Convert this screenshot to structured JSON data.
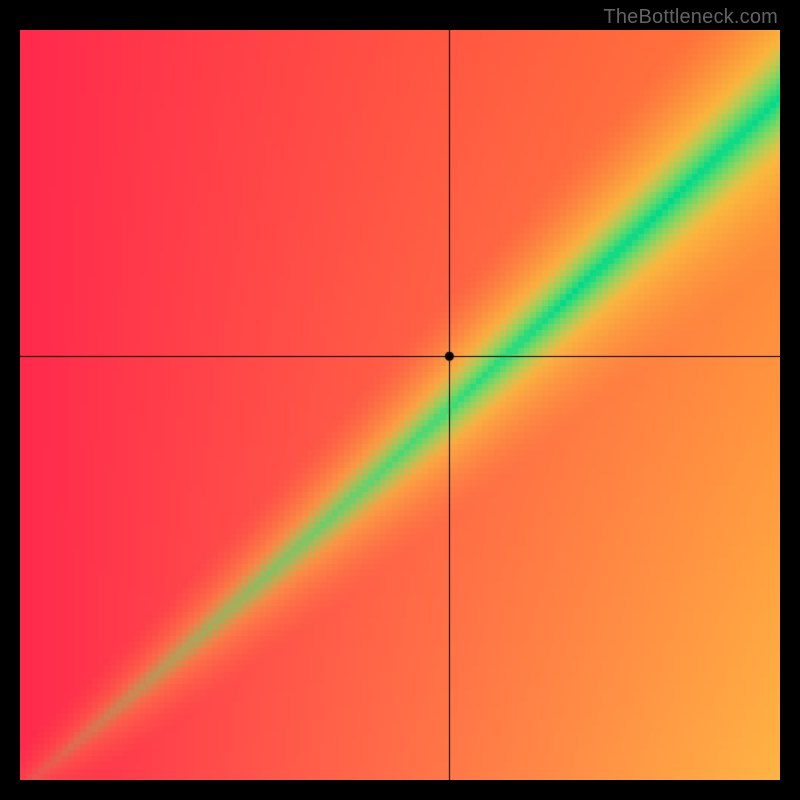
{
  "watermark": "TheBottleneck.com",
  "chart_data": {
    "type": "heatmap",
    "title": "",
    "xlabel": "",
    "ylabel": "",
    "x_range": [
      0,
      1
    ],
    "y_range": [
      0,
      1
    ],
    "crosshair": {
      "x": 0.565,
      "y": 0.565
    },
    "marker": {
      "x": 0.565,
      "y": 0.565
    },
    "diagonal_band": {
      "description": "Ideal-balance band running roughly along y ≈ x from bottom-left to upper-right, widening toward the right.",
      "half_width_start": 0.015,
      "half_width_end": 0.08,
      "color": "#00d98b"
    },
    "background_gradient": {
      "top_left": "#ff2a4d",
      "top_right": "#ffb444",
      "bottom_left": "#ff2a4d",
      "bottom_right": "#ff7a3a",
      "band_halo": "#f6ff3f"
    },
    "legend": [],
    "annotations": []
  }
}
